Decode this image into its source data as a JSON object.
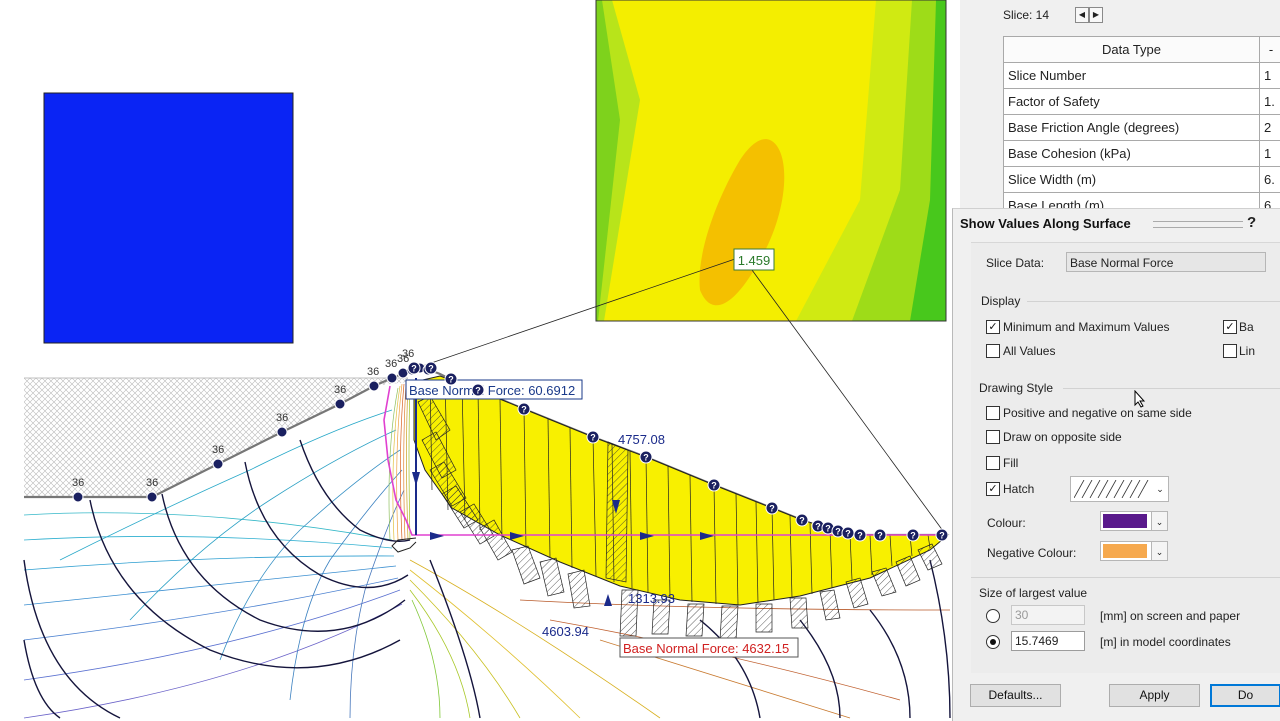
{
  "model": {
    "contour_tooltip": "1.459",
    "min_force_label": "Base Normal Force: 60.6912",
    "max_force_label": "Base Normal Force: 4632.15",
    "value_labels": [
      "4757.08",
      "1313.93",
      "4603.94"
    ],
    "node_labels": [
      "36",
      "36",
      "36",
      "36",
      "36",
      "36",
      "36",
      "36",
      "36"
    ],
    "colors": {
      "blue_block": "#0a24f4",
      "contour_yellow": "#f4ee00",
      "contour_orange": "#f4c000",
      "contour_green": "#3cc01a",
      "fill_yellow": "#f8f000",
      "pink_line": "#e040d0",
      "min_label_border": "#1a3a8a",
      "max_label_color": "#d02020"
    }
  },
  "info_panel": {
    "slice_label": "Slice: 14",
    "prev_icon": "◀",
    "next_icon": "▶",
    "table_header": "Data Type",
    "table_header_value": "-",
    "rows": [
      {
        "label": "Slice Number",
        "value": "1"
      },
      {
        "label": "Factor of Safety",
        "value": "1."
      },
      {
        "label": "Base Friction Angle (degrees)",
        "value": "2"
      },
      {
        "label": "Base Cohesion (kPa)",
        "value": "1"
      },
      {
        "label": "Slice Width (m)",
        "value": "6."
      },
      {
        "label": "Base Length (m)",
        "value": "6"
      }
    ]
  },
  "dialog": {
    "title": "Show Values Along Surface",
    "help": "?",
    "slice_data_label": "Slice Data:",
    "slice_data_value": "Base Normal Force",
    "display_title": "Display",
    "min_max_label": "Minimum and Maximum Values",
    "min_max_checked": true,
    "ba_label": "Ba",
    "ba_checked": true,
    "all_values_label": "All Values",
    "all_values_checked": false,
    "lin_label": "Lin",
    "lin_checked": false,
    "drawing_style_title": "Drawing Style",
    "pos_neg_label": "Positive and negative on same side",
    "pos_neg_checked": false,
    "opposite_label": "Draw on opposite side",
    "opposite_checked": false,
    "fill_label": "Fill",
    "fill_checked": false,
    "hatch_label": "Hatch",
    "hatch_checked": true,
    "colour_label": "Colour:",
    "colour_value": "#5a1a8c",
    "neg_colour_label": "Negative Colour:",
    "neg_colour_value": "#f6a94e",
    "size_title": "Size of largest value",
    "screen_value": "30",
    "screen_label": "[mm] on screen and paper",
    "model_value": "15.7469",
    "model_label": "[m] in model coordinates",
    "model_selected": true,
    "defaults_label": "Defaults...",
    "apply_label": "Apply",
    "done_label": "Do"
  }
}
